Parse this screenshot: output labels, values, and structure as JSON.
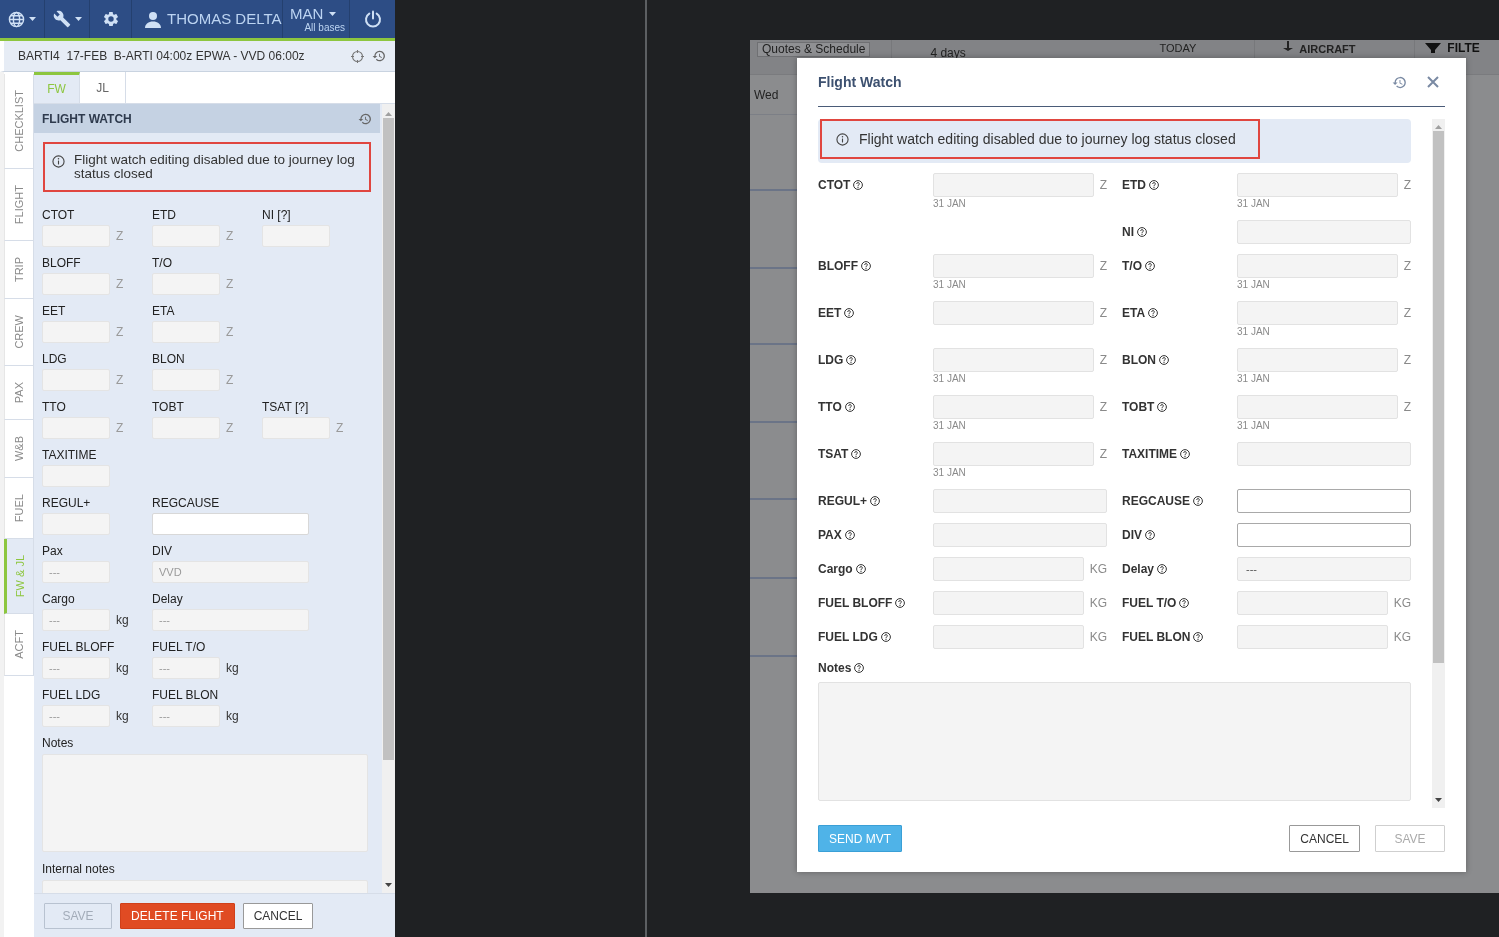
{
  "top_nav": {
    "user": "THOMAS DELTA",
    "base": "MAN",
    "base_note": "All bases"
  },
  "flight_header": "BARTI4  17-FEB  B-ARTI 04:00z EPWA - VVD 06:00z",
  "side_tabs": [
    {
      "label": "CHECKLIST",
      "selected": false
    },
    {
      "label": "FLIGHT",
      "selected": false
    },
    {
      "label": "TRIP",
      "selected": false
    },
    {
      "label": "CREW",
      "selected": false
    },
    {
      "label": "PAX",
      "selected": false
    },
    {
      "label": "W&B",
      "selected": false
    },
    {
      "label": "FUEL",
      "selected": false
    },
    {
      "label": "FW & JL",
      "selected": true
    },
    {
      "label": "ACFT",
      "selected": false
    }
  ],
  "inner_tabs": [
    {
      "label": "FW",
      "selected": true
    },
    {
      "label": "JL",
      "selected": false
    }
  ],
  "panel": {
    "title": "FLIGHT WATCH",
    "alert": "Flight watch editing disabled due to journey log status closed",
    "rows": [
      [
        {
          "label": "CTOT",
          "kind": "time",
          "suffix": "Z",
          "disabled": true
        },
        {
          "label": "ETD",
          "kind": "time",
          "suffix": "Z",
          "disabled": true
        },
        {
          "label": "NI [?]",
          "kind": "number",
          "disabled": true
        }
      ],
      [
        {
          "label": "BLOFF",
          "kind": "time",
          "suffix": "Z",
          "disabled": true
        },
        {
          "label": "T/O",
          "kind": "time",
          "suffix": "Z",
          "disabled": true
        }
      ],
      [
        {
          "label": "EET",
          "kind": "time",
          "suffix": "Z",
          "disabled": true
        },
        {
          "label": "ETA",
          "kind": "time",
          "suffix": "Z",
          "disabled": true
        }
      ],
      [
        {
          "label": "LDG",
          "kind": "time",
          "suffix": "Z",
          "disabled": true
        },
        {
          "label": "BLON",
          "kind": "time",
          "suffix": "Z",
          "disabled": true
        }
      ],
      [
        {
          "label": "TTO",
          "kind": "time",
          "suffix": "Z",
          "disabled": true
        },
        {
          "label": "TOBT",
          "kind": "time",
          "suffix": "Z",
          "disabled": true
        },
        {
          "label": "TSAT [?]",
          "kind": "time",
          "suffix": "Z",
          "disabled": true
        }
      ],
      [
        {
          "label": "TAXITIME",
          "kind": "number",
          "disabled": true
        }
      ],
      [
        {
          "label": "REGUL+",
          "kind": "number",
          "disabled": true
        },
        {
          "label": "REGCAUSE",
          "kind": "text",
          "disabled": false
        }
      ],
      [
        {
          "label": "Pax",
          "kind": "number",
          "placeholder": "---",
          "disabled": true
        },
        {
          "label": "DIV",
          "kind": "text",
          "placeholder": "VVD",
          "disabled": true
        }
      ],
      [
        {
          "label": "Cargo",
          "kind": "quantity",
          "suffix": "kg",
          "placeholder": "---",
          "disabled": true
        },
        {
          "label": "Delay",
          "kind": "text",
          "placeholder": "---",
          "disabled": true
        }
      ],
      [
        {
          "label": "FUEL BLOFF",
          "kind": "quantity",
          "suffix": "kg",
          "placeholder": "---",
          "disabled": true
        },
        {
          "label": "FUEL T/O",
          "kind": "quantity",
          "suffix": "kg",
          "placeholder": "---",
          "disabled": true
        }
      ],
      [
        {
          "label": "FUEL LDG",
          "kind": "quantity",
          "suffix": "kg",
          "placeholder": "---",
          "disabled": true
        },
        {
          "label": "FUEL BLON",
          "kind": "quantity",
          "suffix": "kg",
          "placeholder": "---",
          "disabled": true
        }
      ]
    ],
    "notes_label": "Notes",
    "internal_notes_label": "Internal notes",
    "buttons": [
      {
        "label": "SAVE",
        "kind": "default",
        "disabled": true
      },
      {
        "label": "DELETE FLIGHT",
        "kind": "danger",
        "disabled": false
      },
      {
        "label": "CANCEL",
        "kind": "default",
        "disabled": false
      }
    ]
  },
  "background_app": {
    "schedule_button": "Quotes & Schedule",
    "range": "4 days",
    "today": "TODAY",
    "aircraft": "AIRCRAFT",
    "filter": "FILTE",
    "day": "Wed"
  },
  "dialog": {
    "title": "Flight Watch",
    "alert": "Flight watch editing disabled due to journey log status closed",
    "rows": [
      {
        "left": {
          "label": "CTOT",
          "suffix": "Z",
          "date": "31 JAN",
          "disabled": true
        },
        "right": {
          "label": "ETD",
          "suffix": "Z",
          "date": "31 JAN",
          "disabled": true
        }
      },
      {
        "right": {
          "label": "NI",
          "disabled": true
        }
      },
      {
        "left": {
          "label": "BLOFF",
          "suffix": "Z",
          "date": "31 JAN",
          "disabled": true
        },
        "right": {
          "label": "T/O",
          "suffix": "Z",
          "date": "31 JAN",
          "disabled": true
        }
      },
      {
        "left": {
          "label": "EET",
          "suffix": "Z",
          "disabled": true
        },
        "right": {
          "label": "ETA",
          "suffix": "Z",
          "date": "31 JAN",
          "disabled": true
        }
      },
      {
        "left": {
          "label": "LDG",
          "suffix": "Z",
          "date": "31 JAN",
          "disabled": true
        },
        "right": {
          "label": "BLON",
          "suffix": "Z",
          "date": "31 JAN",
          "disabled": true
        }
      },
      {
        "left": {
          "label": "TTO",
          "suffix": "Z",
          "date": "31 JAN",
          "disabled": true
        },
        "right": {
          "label": "TOBT",
          "suffix": "Z",
          "date": "31 JAN",
          "disabled": true
        }
      },
      {
        "left": {
          "label": "TSAT",
          "suffix": "Z",
          "date": "31 JAN",
          "disabled": true
        },
        "right": {
          "label": "TAXITIME",
          "disabled": true
        }
      },
      {
        "left": {
          "label": "REGUL+",
          "disabled": true
        },
        "right": {
          "label": "REGCAUSE",
          "disabled": false
        }
      },
      {
        "left": {
          "label": "PAX",
          "disabled": true
        },
        "right": {
          "label": "DIV",
          "disabled": false
        }
      },
      {
        "left": {
          "label": "Cargo",
          "suffix": "KG",
          "disabled": true
        },
        "right": {
          "label": "Delay",
          "value": "---",
          "disabled": true
        }
      },
      {
        "left": {
          "label": "FUEL BLOFF",
          "suffix": "KG",
          "disabled": true
        },
        "right": {
          "label": "FUEL T/O",
          "suffix": "KG",
          "disabled": true
        }
      },
      {
        "left": {
          "label": "FUEL LDG",
          "suffix": "KG",
          "disabled": true
        },
        "right": {
          "label": "FUEL BLON",
          "suffix": "KG",
          "disabled": true
        }
      }
    ],
    "notes_label": "Notes",
    "buttons": [
      {
        "label": "SEND MVT",
        "kind": "primary",
        "disabled": false
      },
      {
        "label": "CANCEL",
        "kind": "default",
        "disabled": false
      },
      {
        "label": "SAVE",
        "kind": "default",
        "disabled": true
      }
    ]
  }
}
